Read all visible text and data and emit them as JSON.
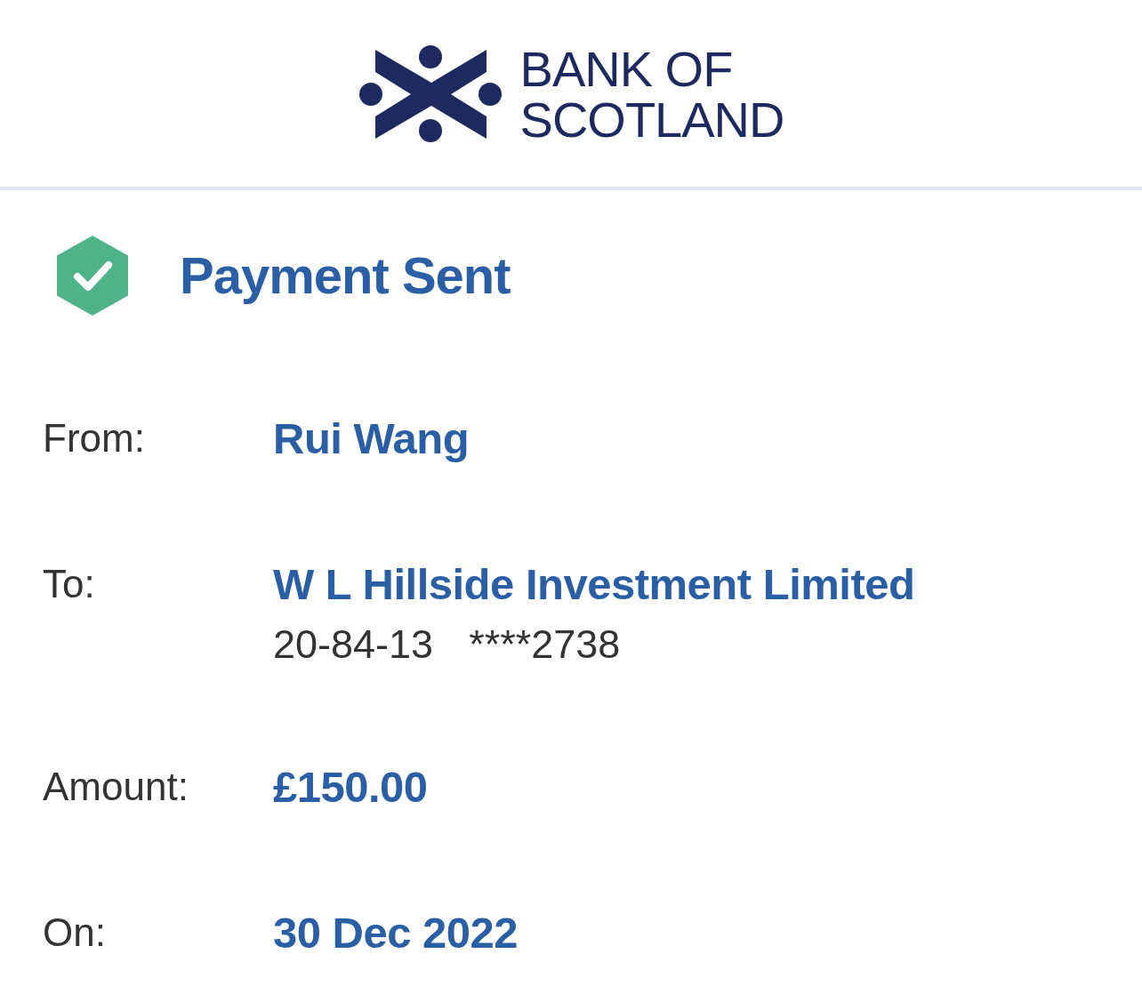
{
  "header": {
    "logo_lines": [
      "BANK OF",
      "SCOTLAND"
    ]
  },
  "status": {
    "kind": "success",
    "title": "Payment Sent"
  },
  "details": [
    {
      "label": "From:",
      "value": "Rui Wang"
    },
    {
      "label": "To:",
      "value": "W L Hillside Investment Limited",
      "sort_code": "20-84-13",
      "account_number": "****2738"
    },
    {
      "label": "Amount:",
      "value": "£150.00"
    },
    {
      "label": "On:",
      "value": "30 Dec 2022"
    }
  ]
}
